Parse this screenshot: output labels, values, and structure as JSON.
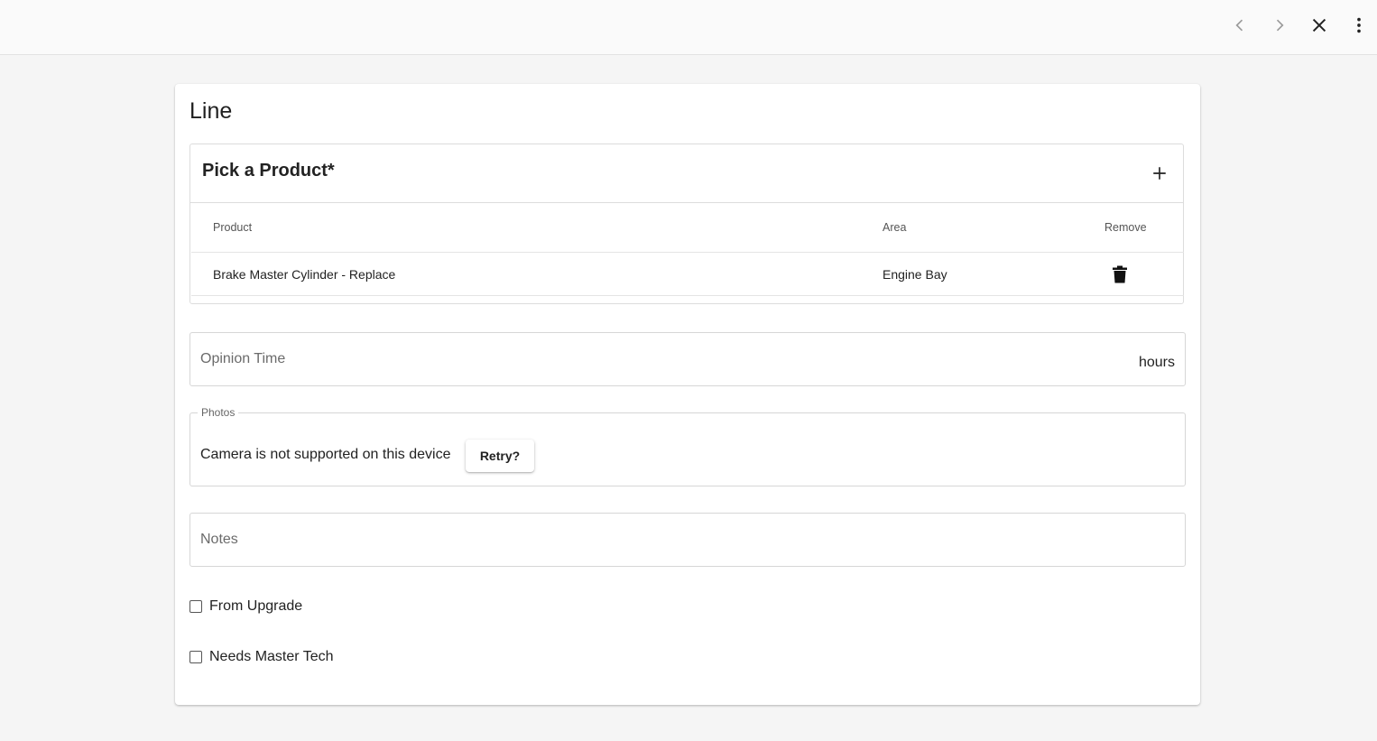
{
  "toolbar": {
    "prev_icon": "chevron-left-icon",
    "next_icon": "chevron-right-icon",
    "close_icon": "close-icon",
    "more_icon": "more-vert-icon"
  },
  "form": {
    "title": "Line",
    "product_picker": {
      "title": "Pick a Product*",
      "add_icon": "plus-icon",
      "columns": [
        "Product",
        "Area",
        "Remove"
      ],
      "rows": [
        {
          "product": "Brake Master Cylinder - Replace",
          "area": "Engine Bay",
          "remove_icon": "trash-icon"
        }
      ]
    },
    "opinion_time": {
      "placeholder": "Opinion Time",
      "suffix": "hours",
      "value": ""
    },
    "photos": {
      "legend": "Photos",
      "message": "Camera is not supported on this device",
      "retry_label": "Retry?"
    },
    "notes": {
      "placeholder": "Notes",
      "value": ""
    },
    "checkboxes": {
      "from_upgrade": {
        "label": "From Upgrade",
        "checked": false
      },
      "needs_master_tech": {
        "label": "Needs Master Tech",
        "checked": false
      }
    }
  },
  "colors": {
    "background": "#f5f5f5",
    "card": "#ffffff",
    "border": "#d6d6d6",
    "text": "#1f1f1f",
    "muted": "#6b6b6b"
  }
}
